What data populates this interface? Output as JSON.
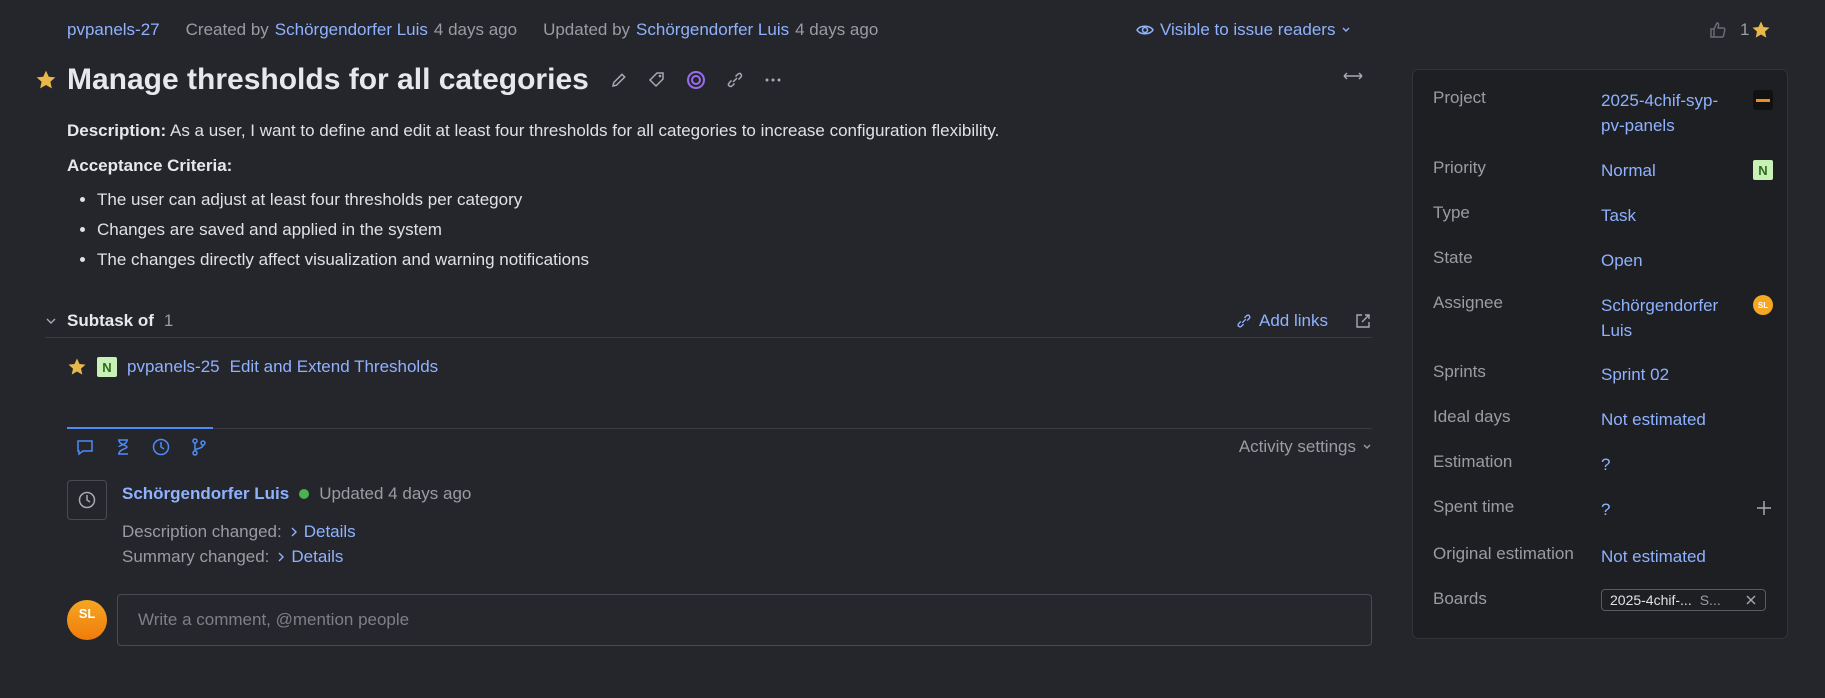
{
  "header": {
    "issue_id": "pvpanels-27",
    "created_prefix": "Created by",
    "created_by": "Schörgendorfer Luis",
    "created_ago": "4 days ago",
    "updated_prefix": "Updated by",
    "updated_by": "Schörgendorfer Luis",
    "updated_ago": "4 days ago",
    "visibility": "Visible to issue readers",
    "vote_count": "1"
  },
  "title": "Manage thresholds for all categories",
  "description": {
    "label": "Description:",
    "text": "As a user, I want to define and edit at least four thresholds for all categories to increase configuration flexibility.",
    "criteria_label": "Acceptance Criteria:",
    "criteria": [
      "The user can adjust at least four thresholds per category",
      "Changes are saved and applied in the system",
      "The changes directly affect visualization and warning notifications"
    ]
  },
  "subtask": {
    "label": "Subtask of",
    "count": "1",
    "add_links": "Add links",
    "item_badge": "N",
    "item_id": "pvpanels-25",
    "item_title": "Edit and Extend Thresholds"
  },
  "activity": {
    "settings_label": "Activity settings",
    "author": "Schörgendorfer Luis",
    "updated": "Updated 4 days ago",
    "changes": [
      {
        "label": "Description changed:",
        "link": "Details"
      },
      {
        "label": "Summary changed:",
        "link": "Details"
      }
    ],
    "comment_placeholder": "Write a comment, @mention people",
    "avatar_initials": "SL"
  },
  "fields": {
    "project": {
      "label": "Project",
      "value": "2025-4chif-syp-pv-panels"
    },
    "priority": {
      "label": "Priority",
      "value": "Normal",
      "badge": "N"
    },
    "type": {
      "label": "Type",
      "value": "Task"
    },
    "state": {
      "label": "State",
      "value": "Open"
    },
    "assignee": {
      "label": "Assignee",
      "value": "Schörgendorfer Luis",
      "initials": "SL"
    },
    "sprints": {
      "label": "Sprints",
      "value": "Sprint 02"
    },
    "ideal_days": {
      "label": "Ideal days",
      "value": "Not estimated"
    },
    "estimation": {
      "label": "Estimation",
      "value": "?"
    },
    "spent_time": {
      "label": "Spent time",
      "value": "?"
    },
    "original_estimation": {
      "label": "Original estimation",
      "value": "Not estimated"
    },
    "boards": {
      "label": "Boards",
      "chip": "2025-4chif-...",
      "chip_suffix": "S..."
    }
  },
  "colors": {
    "background": "#25262b",
    "link": "#8fb2ff",
    "star": "#e8b84a",
    "accent": "#4c8bf5"
  }
}
